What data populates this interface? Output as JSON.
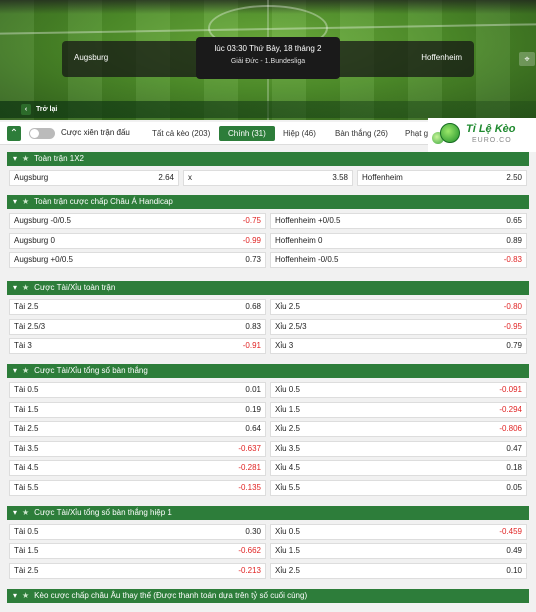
{
  "match": {
    "home": "Augsburg",
    "away": "Hoffenheim",
    "time": "lúc 03:30 Thứ Bảy, 18 tháng 2",
    "league": "Giải Đức - 1.Bundesliga",
    "back_label": "Trở lại"
  },
  "toolbar": {
    "toggle_label": "Cược xiên trận đấu",
    "tabs": [
      {
        "label": "Tất cả kèo (203)"
      },
      {
        "label": "Chính (31)"
      },
      {
        "label": "Hiệp (46)"
      },
      {
        "label": "Bàn thắng (26)"
      },
      {
        "label": "Phạt góc"
      }
    ],
    "active_tab": "Chính (31)"
  },
  "logo": {
    "text": "Tỉ Lệ Kèo",
    "sub": "EURO.CO"
  },
  "sections": [
    {
      "title": "Toàn trận 1X2",
      "layout": "three",
      "rows": [
        [
          {
            "label": "Augsburg",
            "value": "2.64"
          },
          {
            "label": "x",
            "value": "3.58"
          },
          {
            "label": "Hoffenheim",
            "value": "2.50"
          }
        ]
      ]
    },
    {
      "title": "Toàn trận cược chấp Châu Á Handicap",
      "layout": "two",
      "rows": [
        [
          {
            "label": "Augsburg -0/0.5",
            "value": "-0.75"
          },
          {
            "label": "Hoffenheim +0/0.5",
            "value": "0.65"
          }
        ],
        [
          {
            "label": "Augsburg 0",
            "value": "-0.99"
          },
          {
            "label": "Hoffenheim 0",
            "value": "0.89"
          }
        ],
        [
          {
            "label": "Augsburg +0/0.5",
            "value": "0.73"
          },
          {
            "label": "Hoffenheim -0/0.5",
            "value": "-0.83"
          }
        ]
      ]
    },
    {
      "title": "Cược Tài/Xỉu toàn trận",
      "layout": "two",
      "rows": [
        [
          {
            "label": "Tài 2.5",
            "value": "0.68"
          },
          {
            "label": "Xỉu 2.5",
            "value": "-0.80"
          }
        ],
        [
          {
            "label": "Tài 2.5/3",
            "value": "0.83"
          },
          {
            "label": "Xỉu 2.5/3",
            "value": "-0.95"
          }
        ],
        [
          {
            "label": "Tài 3",
            "value": "-0.91"
          },
          {
            "label": "Xỉu 3",
            "value": "0.79"
          }
        ]
      ]
    },
    {
      "title": "Cược Tài/Xỉu tổng số bàn thắng",
      "layout": "two",
      "rows": [
        [
          {
            "label": "Tài 0.5",
            "value": "0.01"
          },
          {
            "label": "Xỉu 0.5",
            "value": "-0.091"
          }
        ],
        [
          {
            "label": "Tài 1.5",
            "value": "0.19"
          },
          {
            "label": "Xỉu 1.5",
            "value": "-0.294"
          }
        ],
        [
          {
            "label": "Tài 2.5",
            "value": "0.64"
          },
          {
            "label": "Xỉu 2.5",
            "value": "-0.806"
          }
        ],
        [
          {
            "label": "Tài 3.5",
            "value": "-0.637"
          },
          {
            "label": "Xỉu 3.5",
            "value": "0.47"
          }
        ],
        [
          {
            "label": "Tài 4.5",
            "value": "-0.281"
          },
          {
            "label": "Xỉu 4.5",
            "value": "0.18"
          }
        ],
        [
          {
            "label": "Tài 5.5",
            "value": "-0.135"
          },
          {
            "label": "Xỉu 5.5",
            "value": "0.05"
          }
        ]
      ]
    },
    {
      "title": "Cược Tài/Xỉu tổng số bàn thắng hiệp 1",
      "layout": "two",
      "rows": [
        [
          {
            "label": "Tài 0.5",
            "value": "0.30"
          },
          {
            "label": "Xỉu 0.5",
            "value": "-0.459"
          }
        ],
        [
          {
            "label": "Tài 1.5",
            "value": "-0.662"
          },
          {
            "label": "Xỉu 1.5",
            "value": "0.49"
          }
        ],
        [
          {
            "label": "Tài 2.5",
            "value": "-0.213"
          },
          {
            "label": "Xỉu 2.5",
            "value": "0.10"
          }
        ]
      ]
    },
    {
      "title": "Kèo cược chấp châu Âu thay thế (Được thanh toán dựa trên tỷ số cuối cùng)",
      "layout": "two",
      "rows": []
    }
  ],
  "colors": {
    "accent": "#2d7d3a",
    "negative": "#e02424"
  },
  "icons": [
    "collapse-icon",
    "star-icon",
    "chevron-left-icon",
    "pin-icon"
  ]
}
